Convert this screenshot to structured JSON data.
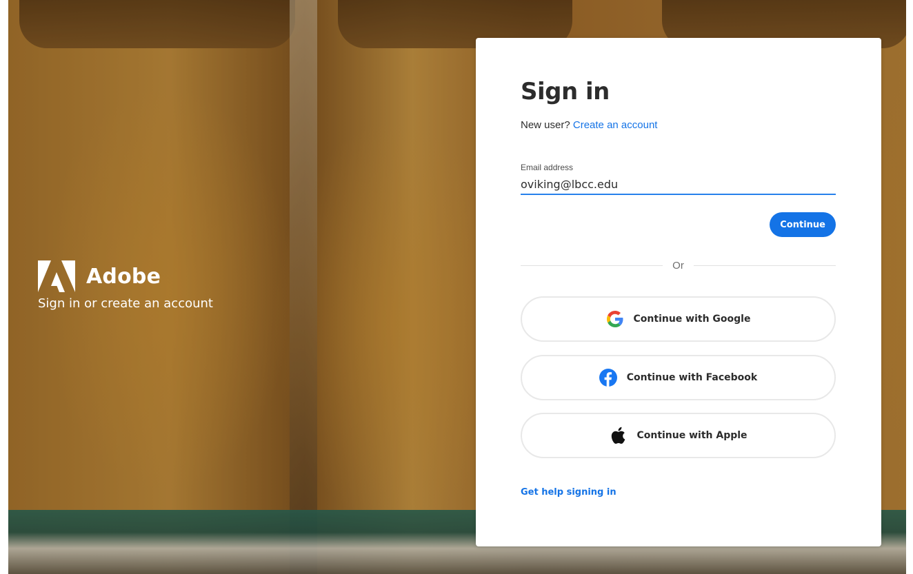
{
  "brand": {
    "name": "Adobe",
    "tagline": "Sign in or create an account",
    "logo_icon": "adobe-logo-icon"
  },
  "signin": {
    "title": "Sign in",
    "new_user_text": "New user?",
    "create_account_link": "Create an account",
    "email_label": "Email address",
    "email_value": "oviking@lbcc.edu",
    "continue_label": "Continue",
    "divider_text": "Or",
    "google_label": "Continue with Google",
    "facebook_label": "Continue with Facebook",
    "apple_label": "Continue with Apple",
    "help_link": "Get help signing in"
  },
  "colors": {
    "accent": "#1473e6",
    "input_underline": "#2680eb",
    "title": "#2c2c2c",
    "facebook": "#1877f2"
  }
}
